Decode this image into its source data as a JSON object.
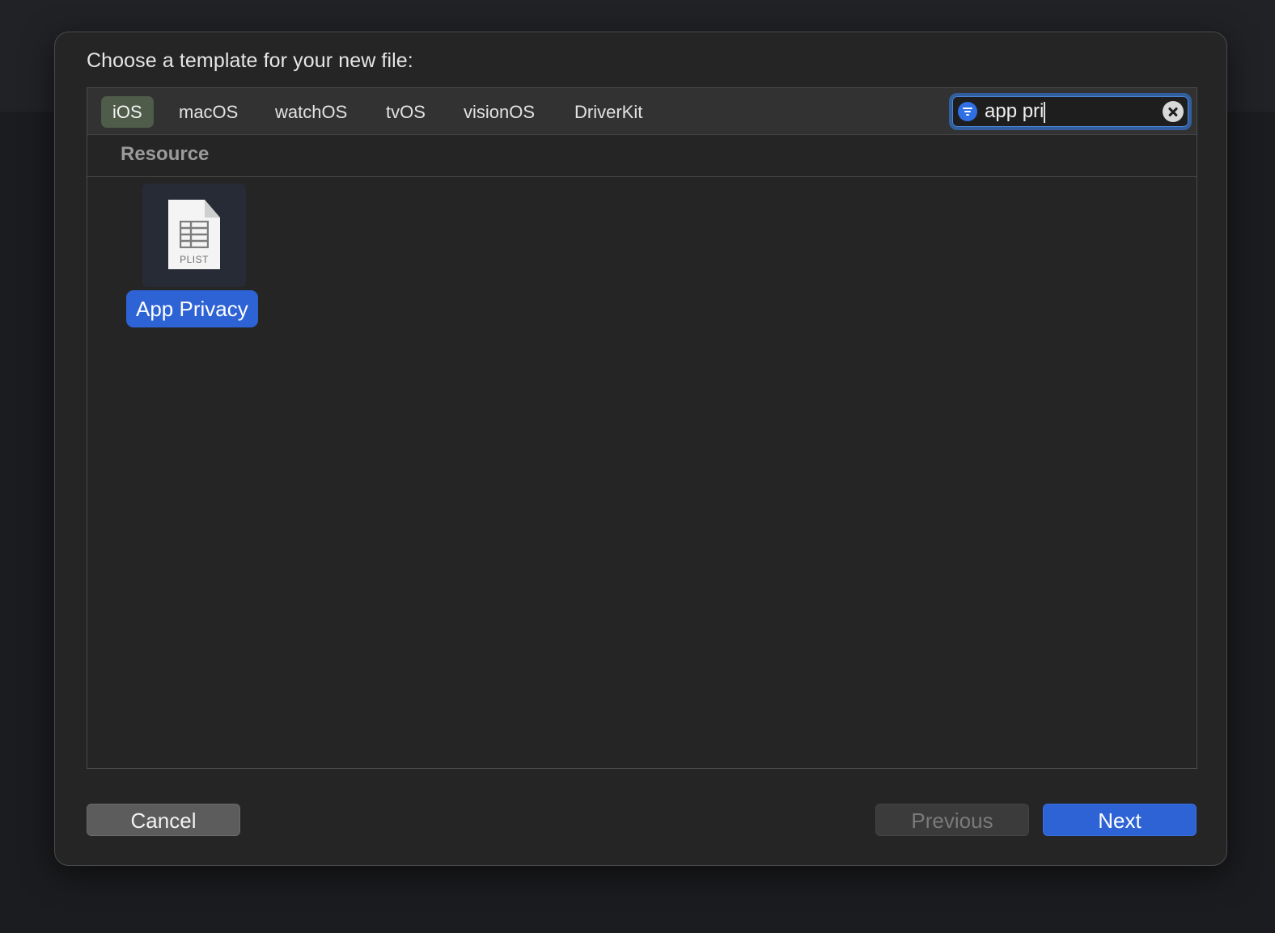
{
  "dialog": {
    "prompt": "Choose a template for your new file:"
  },
  "tabs": [
    {
      "label": "iOS",
      "active": true
    },
    {
      "label": "macOS",
      "active": false
    },
    {
      "label": "watchOS",
      "active": false
    },
    {
      "label": "tvOS",
      "active": false
    },
    {
      "label": "visionOS",
      "active": false
    },
    {
      "label": "DriverKit",
      "active": false
    }
  ],
  "search": {
    "value": "app pri",
    "filter_icon": "filter-icon",
    "clear_icon": "clear-icon"
  },
  "section": {
    "title": "Resource"
  },
  "templates": [
    {
      "label": "App Privacy",
      "icon_text": "PLIST",
      "selected": true
    }
  ],
  "buttons": {
    "cancel": "Cancel",
    "previous": "Previous",
    "next": "Next"
  },
  "colors": {
    "accent": "#2e63d5",
    "active_tab": "#4f5c4a",
    "focus_ring": "#315e9c"
  }
}
